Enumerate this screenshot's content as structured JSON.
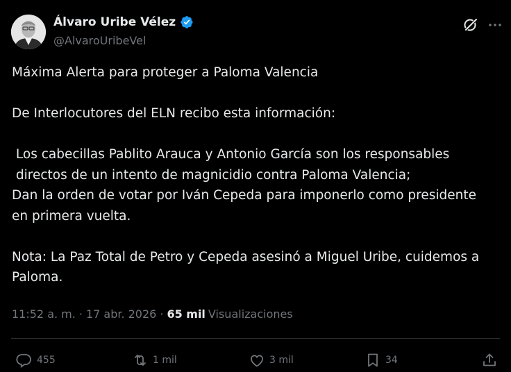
{
  "author": {
    "display_name": "Álvaro Uribe Vélez",
    "handle": "@AlvaroUribeVel",
    "verified": true,
    "verified_color": "#1d9bf0"
  },
  "icons": {
    "verified": "verified-badge-icon",
    "grok": "grok-icon",
    "more": "more-options-icon",
    "reply": "reply-icon",
    "repost": "repost-icon",
    "like": "like-icon",
    "bookmark": "bookmark-icon",
    "share": "share-icon"
  },
  "tweet": {
    "paragraphs": [
      "Máxima Alerta para proteger a Paloma Valencia",
      "De Interlocutores del ELN recibo esta información:",
      " Los cabecillas Pablito Arauca y Antonio García son los responsables\n directos de un intento de magnicidio contra Paloma Valencia;\nDan la orden de votar por Iván Cepeda para imponerlo como presidente\nen primera vuelta.",
      "Nota: La Paz Total de Petro y Cepeda asesinó a Miguel Uribe, cuidemos a\nPaloma."
    ]
  },
  "meta": {
    "time": "11:52 a. m.",
    "separator": "·",
    "date": "17 abr. 2026",
    "views_count": "65 mil",
    "views_label": "Visualizaciones"
  },
  "actions": {
    "replies": "455",
    "reposts": "1 mil",
    "likes": "3 mil",
    "bookmarks": "34"
  },
  "colors": {
    "background": "#000000",
    "text": "#e7e9ea",
    "secondary": "#71767b",
    "divider": "#2f3336"
  }
}
